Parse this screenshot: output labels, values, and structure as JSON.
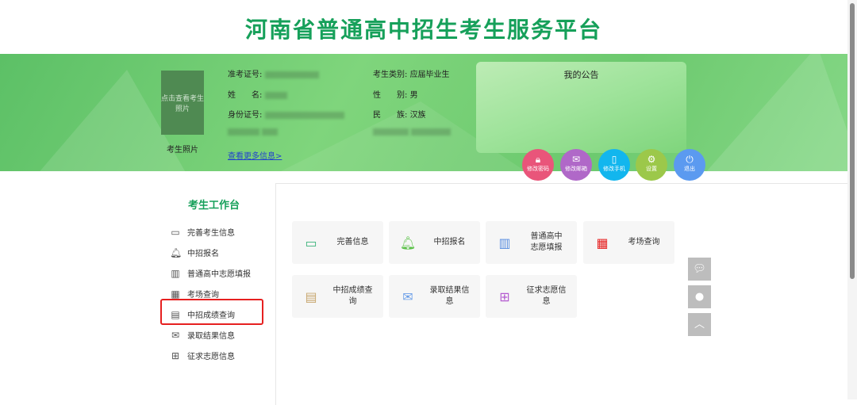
{
  "header": {
    "title": "河南省普通高中招生考生服务平台"
  },
  "profile": {
    "photo_button": "点击查看考生照片",
    "photo_caption": "考生照片",
    "exam_no_label": "准考证号:",
    "name_label": "姓　　名:",
    "id_label": "身份证号:",
    "category_label": "考生类别:",
    "category_value": "应届毕业生",
    "gender_label": "性　　别:",
    "gender_value": "男",
    "ethnicity_label": "民　　族:",
    "ethnicity_value": "汉族",
    "more_link": "查看更多信息>"
  },
  "notice": {
    "title": "我的公告"
  },
  "actions": [
    {
      "label": "修改密码",
      "icon": "lock-icon",
      "color": "#e9557a"
    },
    {
      "label": "修改邮箱",
      "icon": "mail-icon",
      "color": "#b068c8"
    },
    {
      "label": "修改手机",
      "icon": "phone-icon",
      "color": "#12b6ee"
    },
    {
      "label": "设置",
      "icon": "gear-icon",
      "color": "#9cc84a"
    },
    {
      "label": "退出",
      "icon": "power-icon",
      "color": "#5b9af0"
    }
  ],
  "sidebar": {
    "title": "考生工作台",
    "items": [
      {
        "label": "完善考生信息",
        "icon": "id-card-icon"
      },
      {
        "label": "中招报名",
        "icon": "bell-icon"
      },
      {
        "label": "普通高中志愿填报",
        "icon": "building-icon"
      },
      {
        "label": "考场查询",
        "icon": "exam-room-icon"
      },
      {
        "label": "中招成绩查询",
        "icon": "score-sheet-icon"
      },
      {
        "label": "录取结果信息",
        "icon": "envelope-icon"
      },
      {
        "label": "征求志愿信息",
        "icon": "form-add-icon"
      }
    ]
  },
  "cards": [
    {
      "label": "完善信息",
      "icon": "id-card-icon",
      "color": "#3bb37a"
    },
    {
      "label": "中招报名",
      "icon": "bell-icon",
      "color": "#5cc24a"
    },
    {
      "label": "普通高中志愿填报",
      "line1": "普通高中",
      "line2": "志愿填报",
      "icon": "building-icon",
      "color": "#5b8fe0"
    },
    {
      "label": "考场查询",
      "icon": "exam-room-icon",
      "color": "#e62020"
    },
    {
      "label": "中招成绩查询",
      "icon": "score-sheet-icon",
      "color": "#c8a870"
    },
    {
      "label": "录取结果信息",
      "icon": "envelope-icon",
      "color": "#6a9ee8"
    },
    {
      "label": "征求志愿信息",
      "icon": "form-add-icon",
      "color": "#b45ad0"
    }
  ],
  "floating": [
    {
      "icon": "wechat-icon"
    },
    {
      "icon": "qq-icon"
    },
    {
      "icon": "back-to-top-icon"
    }
  ]
}
